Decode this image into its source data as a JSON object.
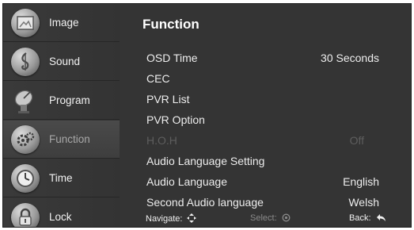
{
  "sidebar": {
    "items": [
      {
        "label": "Image",
        "icon": "image-icon"
      },
      {
        "label": "Sound",
        "icon": "sound-icon"
      },
      {
        "label": "Program",
        "icon": "program-icon"
      },
      {
        "label": "Function",
        "icon": "function-icon",
        "active": true
      },
      {
        "label": "Time",
        "icon": "time-icon"
      },
      {
        "label": "Lock",
        "icon": "lock-icon"
      }
    ]
  },
  "main": {
    "title": "Function",
    "rows": [
      {
        "label": "OSD Time",
        "value": "30 Seconds"
      },
      {
        "label": "CEC",
        "value": ""
      },
      {
        "label": "PVR List",
        "value": ""
      },
      {
        "label": "PVR Option",
        "value": ""
      },
      {
        "label": "H.O.H",
        "value": "Off",
        "disabled": true
      },
      {
        "label": "Audio Language Setting",
        "value": ""
      },
      {
        "label": "Audio Language",
        "value": "English"
      },
      {
        "label": "Second Audio language",
        "value": "Welsh"
      }
    ]
  },
  "footer": {
    "navigate": "Navigate:",
    "select": "Select:",
    "back": "Back:"
  },
  "colors": {
    "background": "#2e2e2e",
    "text": "#ededed",
    "disabled_text": "#5e5e5e",
    "active_sidebar_text": "#a8a8a8"
  }
}
